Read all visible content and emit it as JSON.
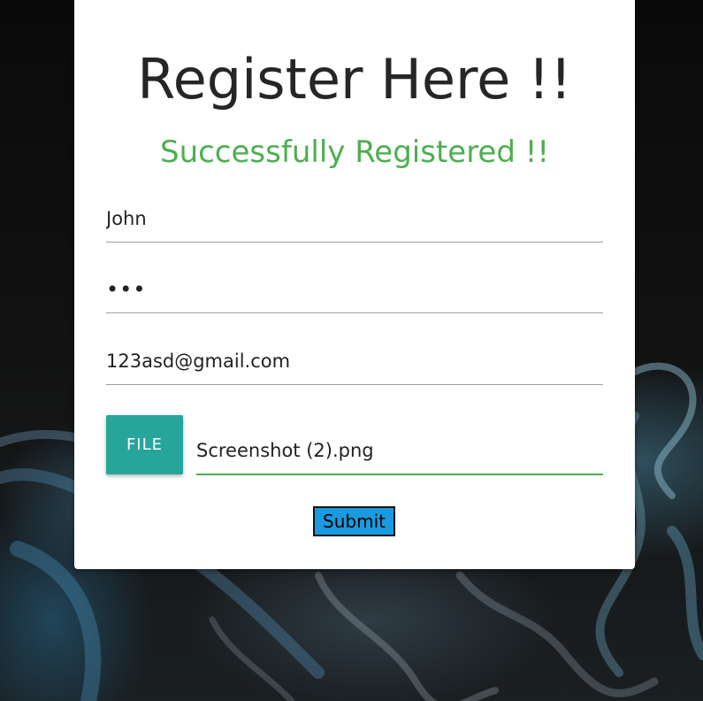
{
  "form": {
    "title": "Register Here !!",
    "status_message": "Successfully Registered !!",
    "name_value": "John",
    "password_display": "•••",
    "email_value": "123asd@gmail.com",
    "file_button_label": "FILE",
    "file_path_value": "Screenshot (2).png",
    "submit_label": "Submit"
  },
  "colors": {
    "success": "#4caf50",
    "file_button": "#26a69a",
    "submit_button": "#1a9ae0",
    "card": "#ffffff"
  }
}
